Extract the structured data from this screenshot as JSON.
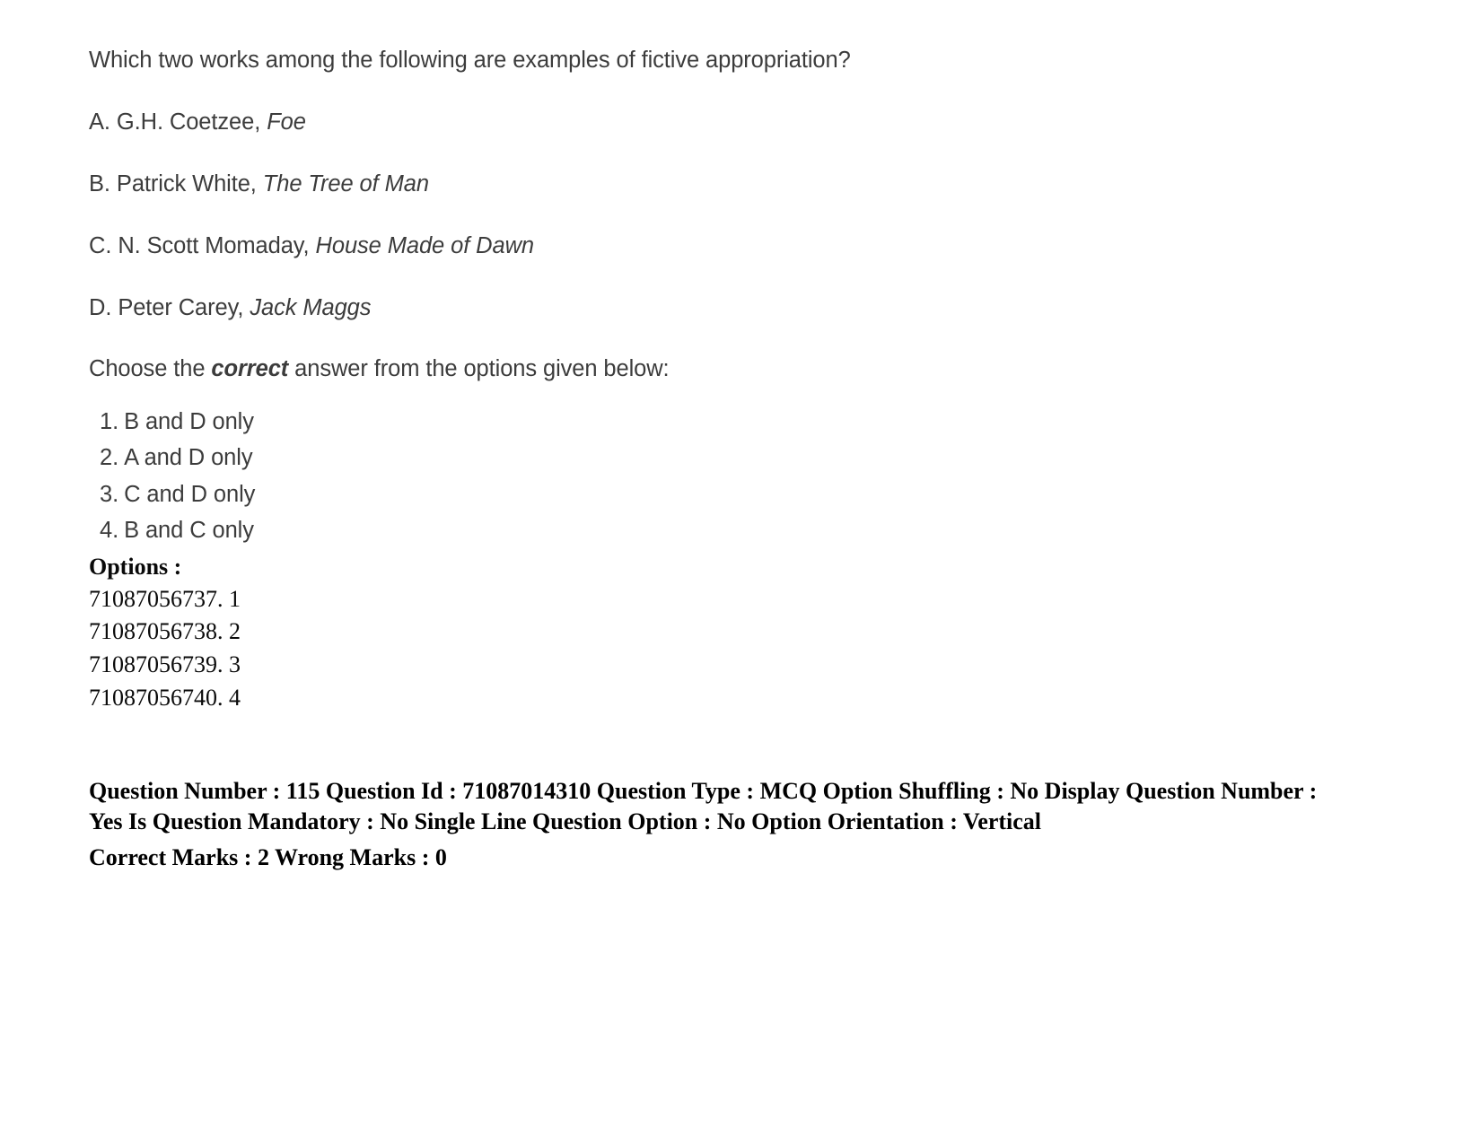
{
  "document": {
    "question_stem": "Which two works among the following are examples of fictive appropriation?",
    "statements": [
      {
        "label": "A.",
        "author": "G.H. Coetzee,",
        "title": "Foe"
      },
      {
        "label": "B.",
        "author": "Patrick White,",
        "title": "The Tree of Man"
      },
      {
        "label": "C.",
        "author": "N. Scott Momaday,",
        "title": "House Made of Dawn"
      },
      {
        "label": "D.",
        "author": "Peter Carey,",
        "title": "Jack Maggs"
      }
    ],
    "choose_prompt": {
      "before": "Choose the ",
      "emphasis": "correct",
      "after": " answer from the options given below:"
    },
    "answer_choices": [
      {
        "num": "1.",
        "text": "B and D only"
      },
      {
        "num": "2.",
        "text": "A and D only"
      },
      {
        "num": "3.",
        "text": "C and D only"
      },
      {
        "num": "4.",
        "text": "B and C only"
      }
    ],
    "options_heading": "Options :",
    "option_ids": [
      "71087056737. 1",
      "71087056738. 2",
      "71087056739. 3",
      "71087056740. 4"
    ],
    "metadata": {
      "line1": "Question Number : 115 Question Id : 71087014310 Question Type : MCQ Option Shuffling : No Display Question Number : Yes Is Question Mandatory : No Single Line Question Option : No Option Orientation : Vertical",
      "line2": "Correct Marks : 2 Wrong Marks : 0"
    }
  }
}
